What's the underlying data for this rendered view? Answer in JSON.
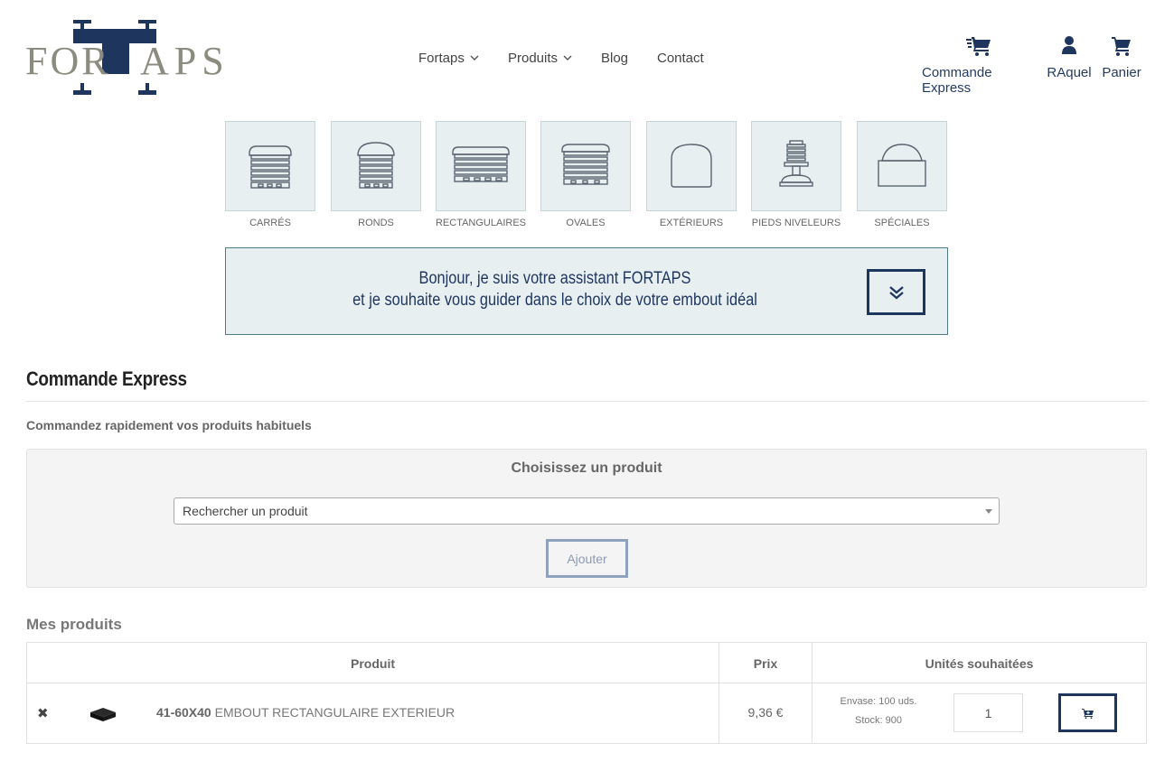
{
  "header": {
    "logo_left": "FOR",
    "logo_right": "APS",
    "nav": [
      {
        "label": "Fortaps",
        "has_dropdown": true
      },
      {
        "label": "Produits",
        "has_dropdown": true
      },
      {
        "label": "Blog",
        "has_dropdown": false
      },
      {
        "label": "Contact",
        "has_dropdown": false
      }
    ],
    "actions": [
      {
        "label": "Commande Express",
        "icon": "express-cart-icon"
      },
      {
        "label": "RAquel",
        "icon": "user-icon"
      },
      {
        "label": "Panier",
        "icon": "cart-icon"
      }
    ]
  },
  "categories": [
    {
      "label": "CARRÉS",
      "icon": "square-cap-icon"
    },
    {
      "label": "RONDS",
      "icon": "round-cap-icon"
    },
    {
      "label": "RECTANGULAIRES",
      "icon": "rectangular-cap-icon"
    },
    {
      "label": "OVALES",
      "icon": "oval-cap-icon"
    },
    {
      "label": "EXTÉRIEURS",
      "icon": "exterior-cap-icon"
    },
    {
      "label": "PIEDS NIVELEURS",
      "icon": "leveling-foot-icon"
    },
    {
      "label": "SPÉCIALES",
      "icon": "special-cap-icon"
    }
  ],
  "assistant": {
    "line1": "Bonjour, je suis votre assistant FORTAPS",
    "line2": "et je souhaite vous guider dans le choix de votre embout idéal"
  },
  "express": {
    "title": "Commande Express",
    "subtitle": "Commandez rapidement vos produits habituels",
    "panel_title": "Choisissez un produit",
    "select_value": "Rechercher un produit",
    "add_label": "Ajouter"
  },
  "my_products": {
    "title": "Mes produits",
    "columns": [
      "Produit",
      "Prix",
      "Unités souhaitées"
    ],
    "rows": [
      {
        "ref": "41-60X40",
        "name": "EMBOUT RECTANGULAIRE EXTERIEUR",
        "price": "9,36 €",
        "envase": "Envase: 100 uds.",
        "stock": "Stock: 900",
        "qty": "1"
      }
    ]
  },
  "colors": {
    "brand_navy": "#1e355e",
    "brand_grey": "#8c8b80",
    "tile_bg": "#e8eff1"
  }
}
